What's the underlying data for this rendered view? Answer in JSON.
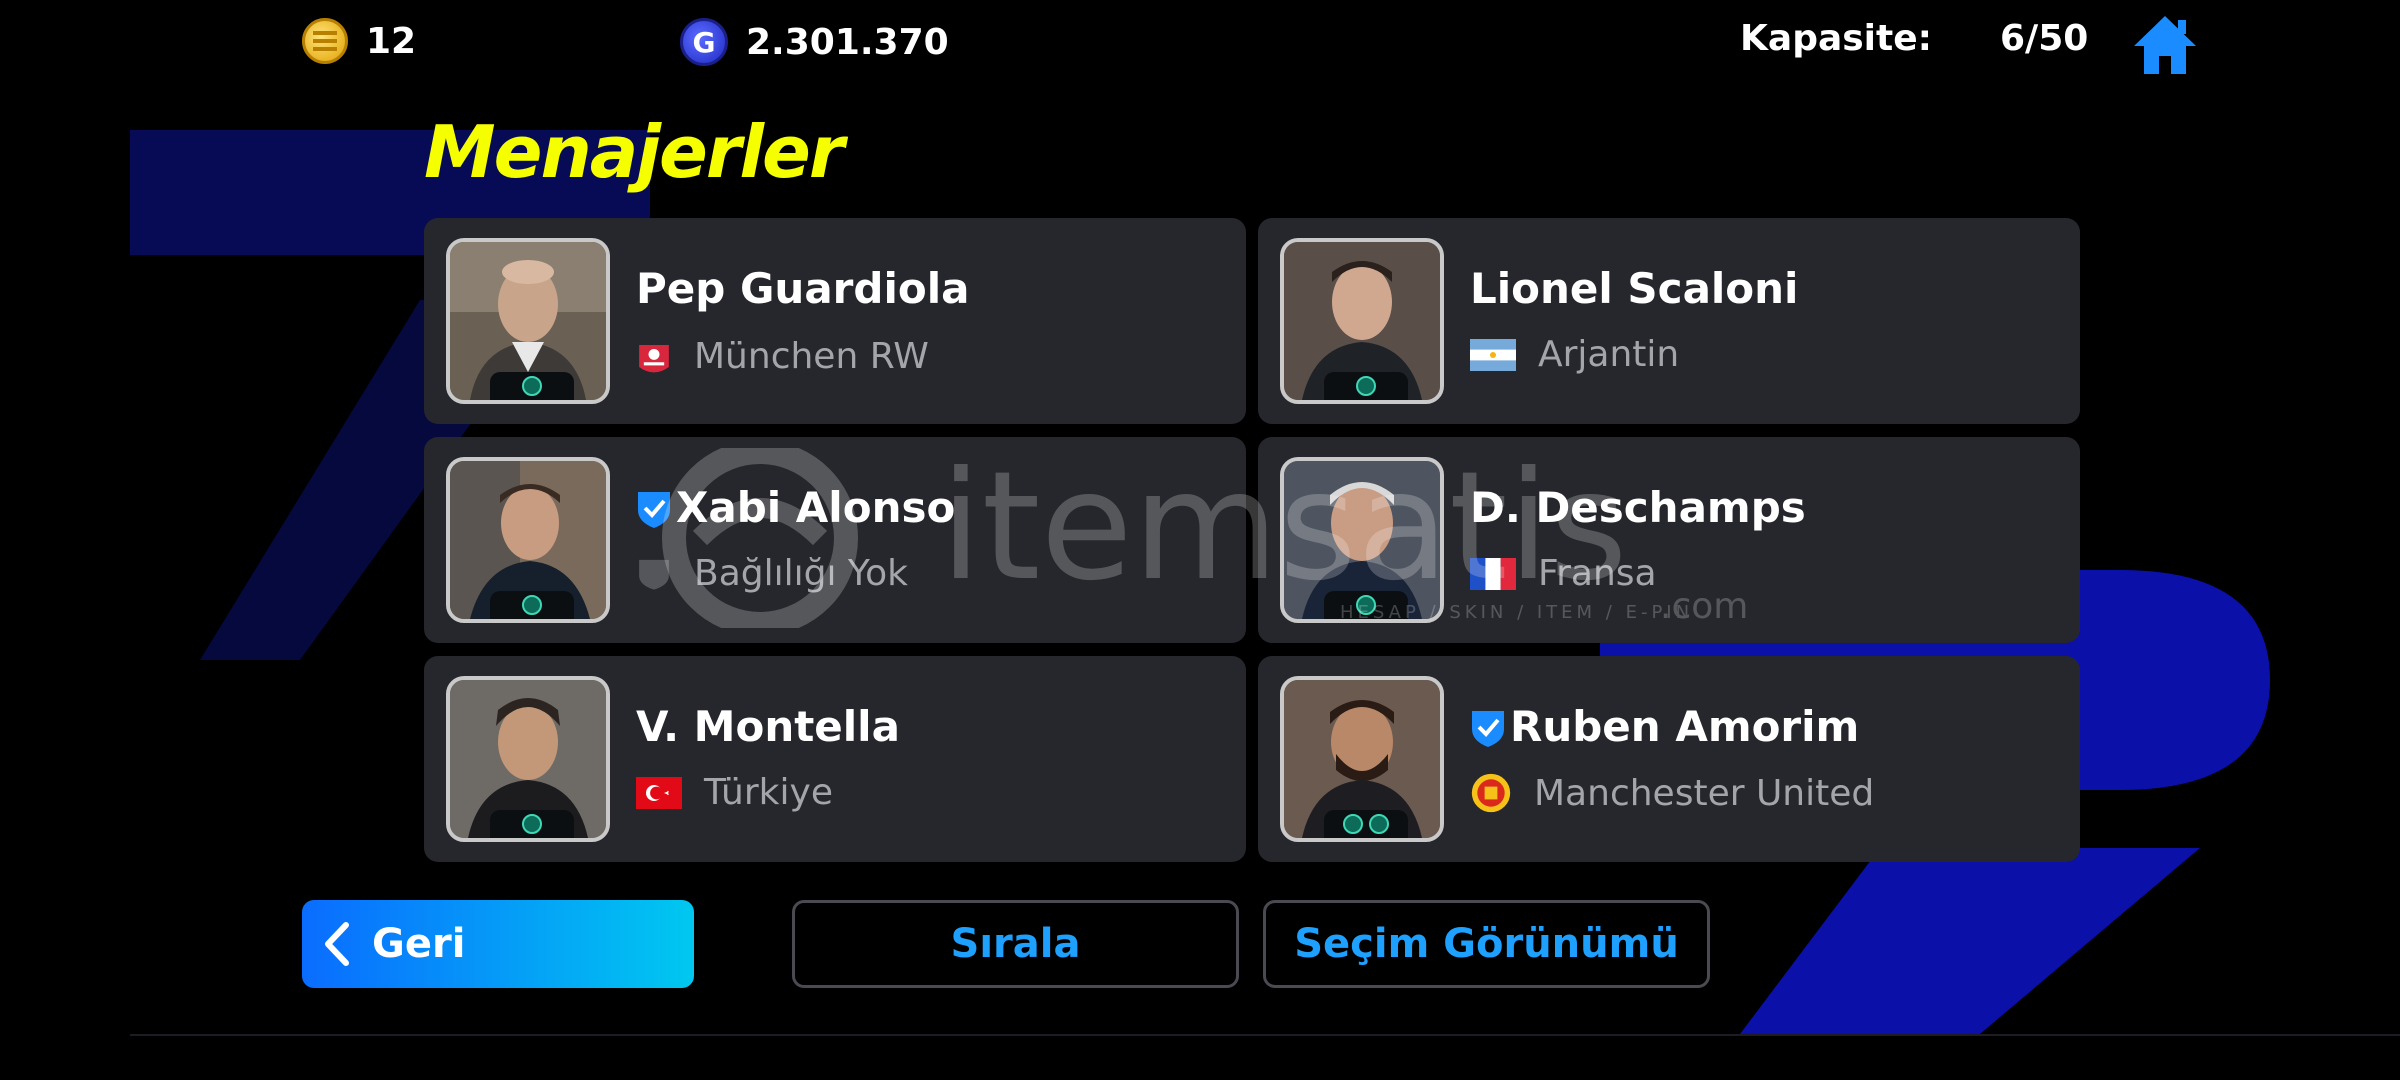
{
  "topbar": {
    "coins_icon": "efootball-coin-icon",
    "coins_value": "12",
    "gp_icon": "gp-icon",
    "gp_value": "2.301.370",
    "capacity_label": "Kapasite:",
    "capacity_value": "6/50",
    "home_icon": "home-icon"
  },
  "page": {
    "title": "Menajerler"
  },
  "managers": [
    {
      "name": "Pep Guardiola",
      "verified": false,
      "team": "München RW",
      "team_icon": "munchen-rw-crest-icon",
      "badges": 1
    },
    {
      "name": "Lionel Scaloni",
      "verified": false,
      "team": "Arjantin",
      "team_icon": "argentina-flag-icon",
      "badges": 1
    },
    {
      "name": "Xabi Alonso",
      "verified": true,
      "team": "Bağlılığı Yok",
      "team_icon": "no-affiliation-shield-icon",
      "badges": 1
    },
    {
      "name": "D. Deschamps",
      "verified": false,
      "team": "Fransa",
      "team_icon": "france-flag-icon",
      "badges": 1
    },
    {
      "name": "V. Montella",
      "verified": false,
      "team": "Türkiye",
      "team_icon": "turkey-flag-icon",
      "badges": 1
    },
    {
      "name": "Ruben Amorim",
      "verified": true,
      "team": "Manchester United",
      "team_icon": "manchester-united-crest-icon",
      "badges": 2
    }
  ],
  "buttons": {
    "back_label": "Geri",
    "sort_label": "Sırala",
    "selection_view_label": "Seçim Görünümü"
  },
  "watermark": {
    "brand": "itemsatis",
    "domain": ".com",
    "tagline": "HESAP / SKIN / ITEM / E-PIN"
  },
  "colors": {
    "title": "#f6ff00",
    "card_bg": "#26272c",
    "accent_blue": "#1ea0ff",
    "back_gradient_start": "#0a6cff",
    "back_gradient_end": "#00c8f0"
  }
}
